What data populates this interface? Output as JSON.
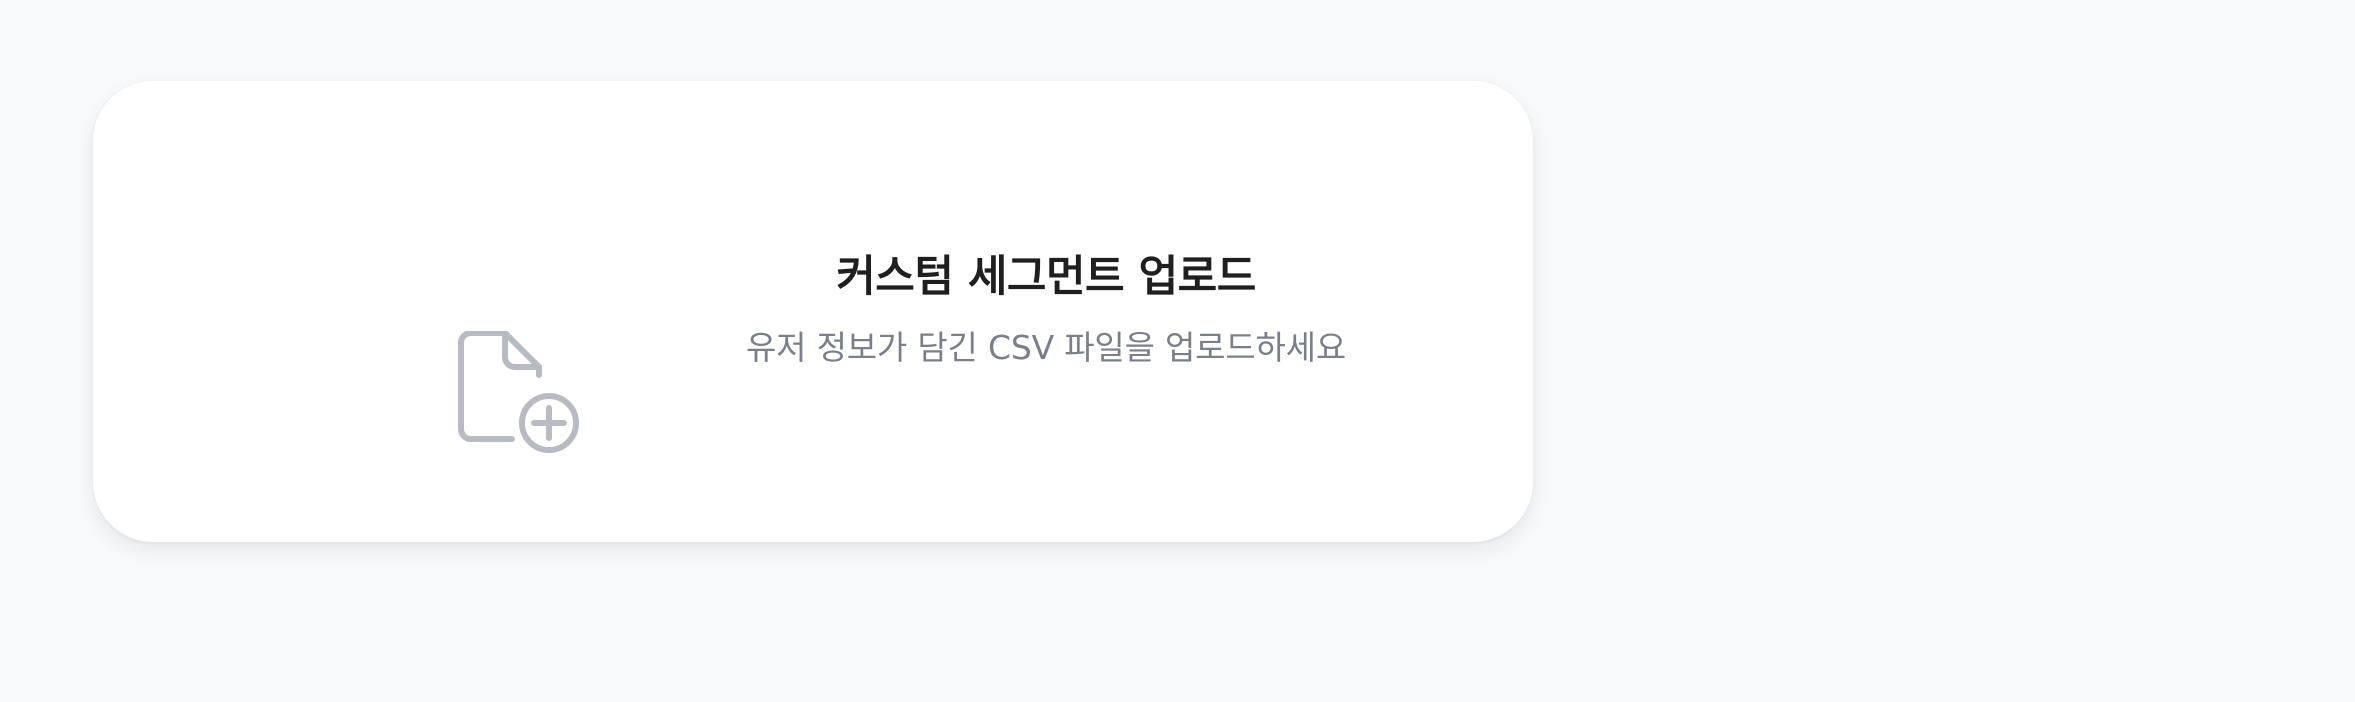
{
  "upload_card": {
    "icon": "file-plus-icon",
    "title": "커스텀 세그먼트 업로드",
    "subtitle": "유저 정보가 담긴 CSV 파일을 업로드하세요",
    "colors": {
      "background": "#f8f9fa",
      "card": "#ffffff",
      "title": "#1f1f1f",
      "subtitle": "#7a7f88",
      "icon": "#b8bbc2"
    }
  }
}
